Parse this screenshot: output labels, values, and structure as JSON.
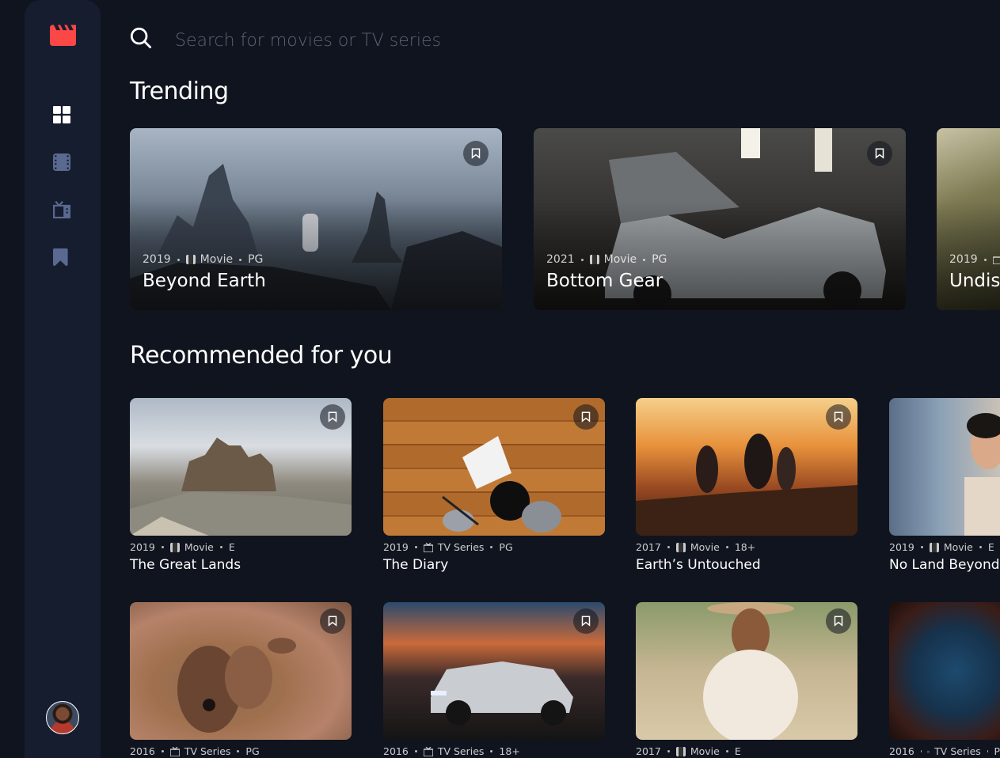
{
  "search": {
    "placeholder": "Search for movies or TV series"
  },
  "sections": {
    "trending": "Trending",
    "recommended": "Recommended for you"
  },
  "trending": [
    {
      "year": "2019",
      "category": "Movie",
      "rating": "PG",
      "title": "Beyond Earth"
    },
    {
      "year": "2021",
      "category": "Movie",
      "rating": "PG",
      "title": "Bottom Gear"
    },
    {
      "year": "2019",
      "category": "",
      "rating": "",
      "title": "Undisc"
    }
  ],
  "recommended": [
    {
      "year": "2019",
      "category": "Movie",
      "rating": "E",
      "title": "The Great Lands"
    },
    {
      "year": "2019",
      "category": "TV Series",
      "rating": "PG",
      "title": "The Diary"
    },
    {
      "year": "2017",
      "category": "Movie",
      "rating": "18+",
      "title": "Earth’s Untouched"
    },
    {
      "year": "2019",
      "category": "Movie",
      "rating": "E",
      "title": "No Land Beyond"
    },
    {
      "year": "2016",
      "category": "TV Series",
      "rating": "PG",
      "title": ""
    },
    {
      "year": "2016",
      "category": "TV Series",
      "rating": "18+",
      "title": ""
    },
    {
      "year": "2017",
      "category": "Movie",
      "rating": "E",
      "title": ""
    },
    {
      "year": "2016",
      "category": "TV Series",
      "rating": "P",
      "title": ""
    }
  ],
  "icons": {
    "logo": "film-clapper-icon",
    "nav": [
      "home-grid-icon",
      "movies-film-icon",
      "tv-series-icon",
      "bookmark-icon"
    ],
    "search": "search-icon",
    "bookmark": "bookmark-outline-icon"
  },
  "colors": {
    "background": "#10141e",
    "sidebar": "#161d2f",
    "accent": "#fc4747",
    "nav_inactive": "#5a698f"
  }
}
